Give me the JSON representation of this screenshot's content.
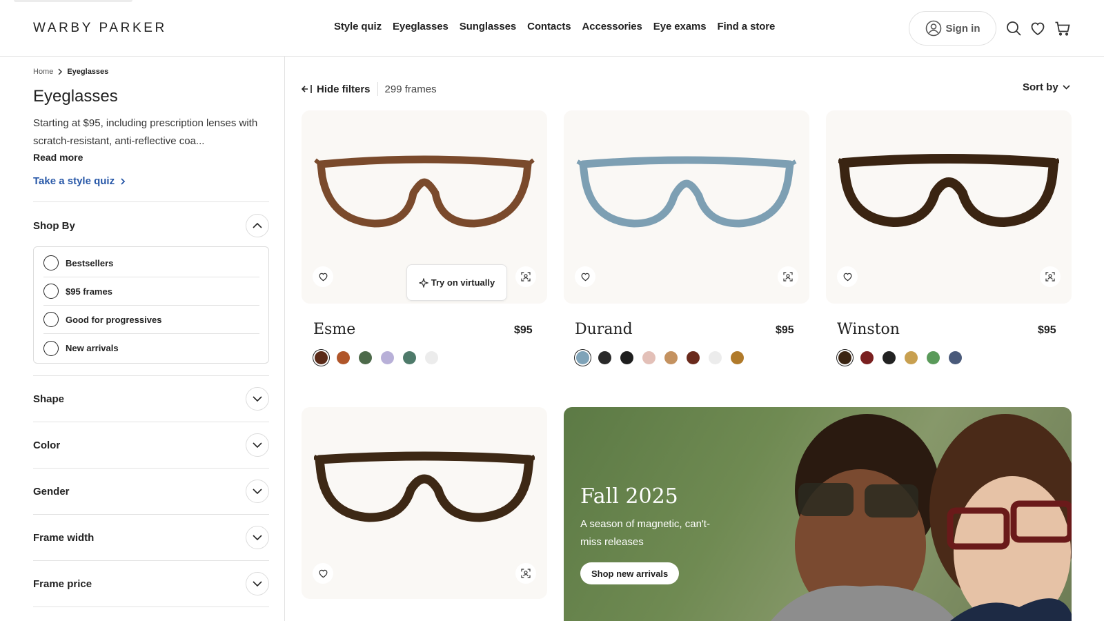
{
  "header": {
    "logo": "WARBY PARKER",
    "nav": [
      "Style quiz",
      "Eyeglasses",
      "Sunglasses",
      "Contacts",
      "Accessories",
      "Eye exams",
      "Find a store"
    ],
    "signin": "Sign in"
  },
  "sidebar": {
    "breadcrumb": [
      "Home",
      "Eyeglasses"
    ],
    "title": "Eyeglasses",
    "description": "Starting at $95, including prescription lenses with scratch-resistant, anti-reflective coa...",
    "read_more": "Read more",
    "quiz_link": "Take a style quiz",
    "shop_by": {
      "label": "Shop By",
      "options": [
        "Bestsellers",
        "$95 frames",
        "Good for progressives",
        "New arrivals"
      ]
    },
    "filters": [
      "Shape",
      "Color",
      "Gender",
      "Frame width",
      "Frame price"
    ]
  },
  "toolbar": {
    "hide_filters": "Hide filters",
    "count": "299 frames",
    "sort": "Sort by"
  },
  "products": [
    {
      "name": "Esme",
      "price": "$95",
      "frame_color": "#7a4a2c",
      "swatches": [
        "#5a2a18",
        "#b0562a",
        "#4d6a4a",
        "#b8b0d8",
        "#4e7a6a",
        "#ececec"
      ]
    },
    {
      "name": "Durand",
      "price": "$95",
      "frame_color": "#7d9fb3",
      "swatches": [
        "#7fa3b8",
        "#2a2a2a",
        "#1e1e1e",
        "#e3c0b8",
        "#c49260",
        "#6a2a1c",
        "#ececec",
        "#b07a2a"
      ]
    },
    {
      "name": "Winston",
      "price": "$95",
      "frame_color": "#3a2412",
      "swatches": [
        "#3a2412",
        "#7a2020",
        "#222222",
        "#c8a050",
        "#5a9a5a",
        "#4a5a7a"
      ]
    },
    {
      "name": "",
      "price": "",
      "frame_color": "#3d2815",
      "swatches": []
    }
  ],
  "try_on": "Try on virtually",
  "promo": {
    "title": "Fall 2025",
    "subtitle": "A season of magnetic, can't-miss releases",
    "cta": "Shop new arrivals"
  }
}
